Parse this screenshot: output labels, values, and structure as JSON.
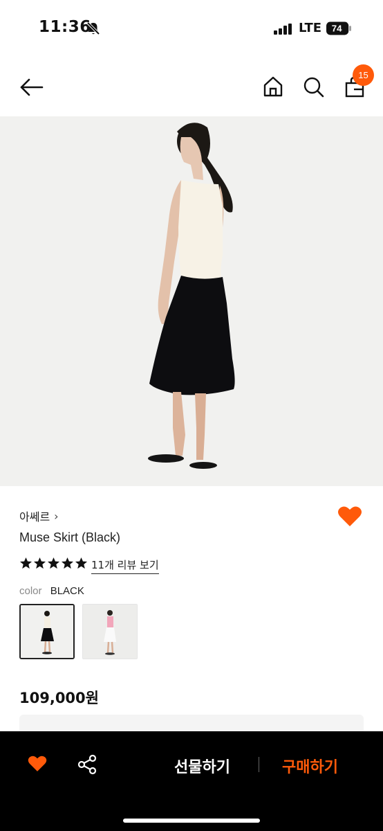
{
  "status_bar": {
    "time": "11:36",
    "network": "LTE",
    "battery": "74"
  },
  "header": {
    "cart_count": "15"
  },
  "product": {
    "brand": "아쎄르",
    "brand_chevron": "›",
    "name": "Muse Skirt (Black)",
    "rating_stars": 5,
    "review_link": "11개 리뷰 보기",
    "color_label": "color",
    "color_value": "BLACK",
    "price": "109,000원",
    "liked": true
  },
  "bottom_bar": {
    "gift_label": "선물하기",
    "buy_label": "구매하기"
  },
  "colors": {
    "accent": "#ff5a0a",
    "bar_bg": "#000000"
  }
}
